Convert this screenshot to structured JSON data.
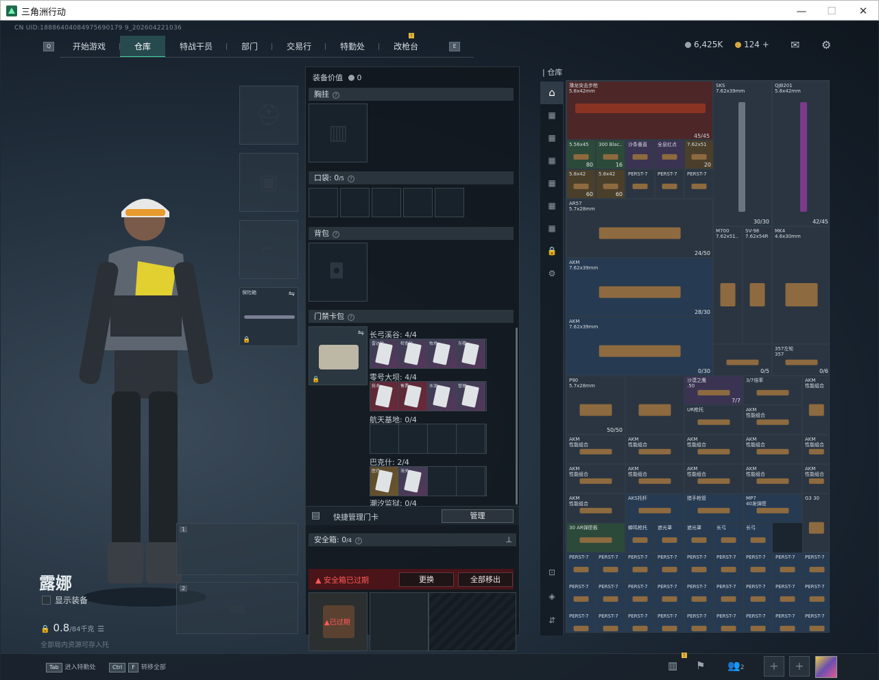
{
  "window": {
    "title": "三角洲行动",
    "min": "—",
    "max": "☐",
    "close": "✕"
  },
  "uid": "CN UID:18886404084975690179 9_202604221036",
  "nav": {
    "tabs": [
      "开始游戏",
      "仓库",
      "特战干员",
      "部门",
      "交易行",
      "特勤处",
      "改枪台"
    ],
    "left_key": "Q",
    "right_key": "E"
  },
  "currency": {
    "coins": "6,425K",
    "tickets": "124",
    "plus": "+"
  },
  "character": {
    "name": "露娜",
    "show_equipment": "显示装备",
    "weight": "0.8",
    "weight_max": "/84千克",
    "weight_note": "全部局内资源可存入托"
  },
  "weapon_slot": {
    "label": "保险箱",
    "num1": "1",
    "num2": "2"
  },
  "equip": {
    "value_label": "装备价值",
    "value": "0",
    "chest": "胸挂",
    "pocket": "口袋:",
    "pocket_count": "0",
    "pocket_max": "/5",
    "backpack": "背包",
    "keycard": "门禁卡包",
    "groups": [
      {
        "label": "长弓溪谷: 4/4",
        "cards": [
          "雷达站",
          "检查站",
          "牧场",
          "东楼"
        ]
      },
      {
        "label": "零号大坝: 4/4",
        "cards": [
          "技术",
          "售票",
          "水泥",
          "管理"
        ]
      },
      {
        "label": "航天基地: 0/4",
        "cards": []
      },
      {
        "label": "巴克什: 2/4",
        "cards": [
          "医疗",
          "海关"
        ]
      },
      {
        "label": "潮汐监狱: 0/4",
        "cards": []
      }
    ],
    "quick_manage": "快捷管理门卡",
    "manage": "管理",
    "safe_box": "安全箱:",
    "safe_count": "0",
    "safe_max": "/4",
    "expired_msg": "▲ 安全箱已过期",
    "replace": "更换",
    "move_all": "全部移出",
    "expired_tag": "▲已过期"
  },
  "stash": {
    "title": "仓库",
    "items": {
      "rifle1": {
        "name": "薄龙突击步枪\n5.8x42mm"
      },
      "sks": {
        "name": "SKS\n7.62x39mm"
      },
      "qbz": {
        "name": "QJB201\n5.8x42mm",
        "count": "42/45"
      },
      "ammo_row1": [
        [
          "5.56x45",
          "80"
        ],
        [
          "300 Blac..",
          "16"
        ],
        [
          "沙条垂直",
          ""
        ],
        [
          "全息红点",
          ""
        ],
        [
          "7.62x51",
          "20"
        ]
      ],
      "ammo_row2": [
        [
          "5.8x42",
          "60"
        ],
        [
          "5.8x42",
          "60"
        ],
        [
          "PERST-7",
          ""
        ],
        [
          "PERST-7",
          ""
        ],
        [
          "PERST-7",
          ""
        ]
      ],
      "ar57": {
        "name": "AR57\n5.7x28mm",
        "count": "24/50"
      },
      "sks_count": "45/45",
      "qbz_count2": "30/30",
      "m700": "M700\n7.62x51..",
      "sv98": "SV-98\n7.62x54R",
      "mk4": "MK4\n4.6x30mm",
      "akm1": {
        "name": "AKM\n7.62x39mm",
        "count": "28/30"
      },
      "akm2": {
        "name": "AKM\n7.62x39mm",
        "count": "0/30"
      },
      "c05": "0/5",
      "c48": "0/48",
      "c06": "0/6",
      "deagle": "357左轮\n357",
      "p90": {
        "name": "P90\n5.7x28mm",
        "count": "50/50"
      },
      "shotgun": "沙漠之鹰\n.50",
      "shot_count": "7/7",
      "scope": "3/7倍率",
      "ur": "UR枪托",
      "akm_label": "AKM\n性能组合",
      "aks": "AKS托杆",
      "stock": "猎手枪管",
      "mp7": "MP7\n40发弹匣",
      "g3": "G3 30",
      "ar30": "30 AR弹匣板",
      "grip": "蝉鸣枪托",
      "sil1": "遮光罩",
      "sil2": "遮光罩",
      "long1": "长弓",
      "long2": "长弓",
      "peq": "PEQ-2",
      "perst": "PERST-7",
      "laser": "共振消音"
    }
  },
  "footer": {
    "tab_key": "Tab",
    "tab_text": "进入特勤处",
    "ctrl": "Ctrl",
    "f": "F",
    "ctrl_text": "转移全部",
    "squad": "2"
  }
}
